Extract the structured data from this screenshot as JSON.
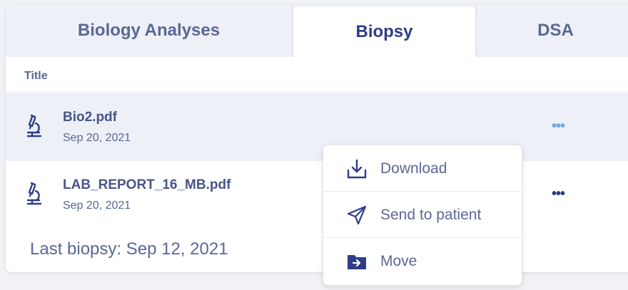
{
  "tabs": [
    {
      "label": "Biology Analyses",
      "active": false
    },
    {
      "label": "Biopsy",
      "active": true
    },
    {
      "label": "DSA",
      "active": false
    }
  ],
  "table": {
    "column_title": "Title",
    "rows": [
      {
        "name": "Bio2.pdf",
        "date": "Sep 20, 2021",
        "icon": "microscope-icon",
        "more": "•••"
      },
      {
        "name": "LAB_REPORT_16_MB.pdf",
        "date": "Sep 20, 2021",
        "icon": "microscope-icon",
        "more": "•••"
      }
    ]
  },
  "summary": "Last biopsy: Sep 12, 2021",
  "context_menu": {
    "items": [
      {
        "label": "Download",
        "icon": "download-icon"
      },
      {
        "label": "Send to patient",
        "icon": "send-icon"
      },
      {
        "label": "Move",
        "icon": "folder-move-icon"
      }
    ]
  },
  "colors": {
    "accent_dark": "#2f3d86",
    "text_muted": "#5b6796",
    "highlight_more": "#6aa8e8",
    "tab_bg": "#edf0f6"
  }
}
